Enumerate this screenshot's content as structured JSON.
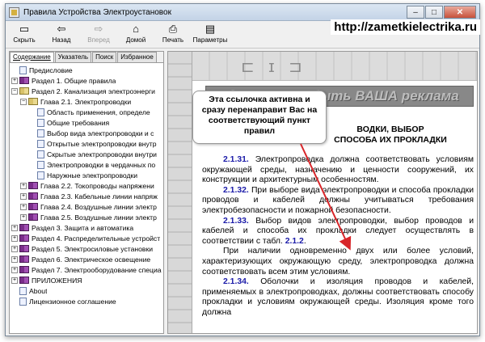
{
  "window": {
    "title": "Правила Устройства Электроустановок",
    "minimize_glyph": "–",
    "maximize_glyph": "□",
    "close_glyph": "✕"
  },
  "watermark": "http://zametkielectrika.ru",
  "toolbar": [
    {
      "name": "hide",
      "label": "Скрыть",
      "icon": "hide-icon",
      "glyph": "▭",
      "enabled": true
    },
    {
      "name": "back",
      "label": "Назад",
      "icon": "back-arrow-icon",
      "glyph": "⇦",
      "enabled": true
    },
    {
      "name": "forward",
      "label": "Вперед",
      "icon": "forward-arrow-icon",
      "glyph": "⇨",
      "enabled": false
    },
    {
      "name": "home",
      "label": "Домой",
      "icon": "home-icon",
      "glyph": "⌂",
      "enabled": true
    },
    {
      "name": "print",
      "label": "Печать",
      "icon": "printer-icon",
      "glyph": "⎙",
      "enabled": true
    },
    {
      "name": "options",
      "label": "Параметры",
      "icon": "options-icon",
      "glyph": "▤",
      "enabled": true
    }
  ],
  "tabs": [
    {
      "label": "Содержание",
      "active": true
    },
    {
      "label": "Указатель",
      "active": false
    },
    {
      "label": "Поиск",
      "active": false
    },
    {
      "label": "Избранное",
      "active": false
    }
  ],
  "tree": [
    {
      "level": 0,
      "type": "page",
      "expander": "",
      "label": "Предисловие"
    },
    {
      "level": 0,
      "type": "book",
      "expander": "+",
      "label": "Раздел 1. Общие правила"
    },
    {
      "level": 0,
      "type": "book-open",
      "expander": "−",
      "label": "Раздел 2. Канализация электроэнерги"
    },
    {
      "level": 1,
      "type": "book-open",
      "expander": "−",
      "label": "Глава 2.1. Электропроводки"
    },
    {
      "level": 2,
      "type": "page",
      "expander": "",
      "label": "Область применения, определе"
    },
    {
      "level": 2,
      "type": "page",
      "expander": "",
      "label": "Общие требования"
    },
    {
      "level": 2,
      "type": "page",
      "expander": "",
      "label": "Выбор вида электропроводки и с"
    },
    {
      "level": 2,
      "type": "page",
      "expander": "",
      "label": "Открытые электропроводки внутр"
    },
    {
      "level": 2,
      "type": "page",
      "expander": "",
      "label": "Скрытые электропроводки внутри"
    },
    {
      "level": 2,
      "type": "page",
      "expander": "",
      "label": "Электропроводки в чердачных по"
    },
    {
      "level": 2,
      "type": "page",
      "expander": "",
      "label": "Наружные электропроводки"
    },
    {
      "level": 1,
      "type": "book",
      "expander": "+",
      "label": "Глава 2.2. Токопроводы напряжени"
    },
    {
      "level": 1,
      "type": "book",
      "expander": "+",
      "label": "Глава 2.3. Кабельные линии напряж"
    },
    {
      "level": 1,
      "type": "book",
      "expander": "+",
      "label": "Глава 2.4. Воздушные линии электр"
    },
    {
      "level": 1,
      "type": "book",
      "expander": "+",
      "label": "Глава 2.5. Воздушные линии электр"
    },
    {
      "level": 0,
      "type": "book",
      "expander": "+",
      "label": "Раздел 3. Защита и автоматика"
    },
    {
      "level": 0,
      "type": "book",
      "expander": "+",
      "label": "Раздел 4. Распределительные устройст"
    },
    {
      "level": 0,
      "type": "book",
      "expander": "+",
      "label": "Раздел 5. Электросиловые установки"
    },
    {
      "level": 0,
      "type": "book",
      "expander": "+",
      "label": "Раздел 6. Электрическое освещение"
    },
    {
      "level": 0,
      "type": "book",
      "expander": "+",
      "label": "Раздел 7. Электрооборудование специа"
    },
    {
      "level": 0,
      "type": "book",
      "expander": "+",
      "label": "ПРИЛОЖЕНИЯ"
    },
    {
      "level": 0,
      "type": "page",
      "expander": "",
      "label": "About"
    },
    {
      "level": 0,
      "type": "page",
      "expander": "",
      "label": "Лицензионное соглашение"
    }
  ],
  "content": {
    "header_glyphs": "⊏ ɪ ⊐",
    "banner": "Здесь могла быть ВАША реклама",
    "heading_line1": "ВОДКИ, ВЫБОР",
    "heading_line2": "СПОСОБА ИХ ПРОКЛАДКИ",
    "paragraphs": [
      {
        "num": "2.1.31.",
        "text": " Электропроводка должна соответствовать условиям окружающей среды, назначению и ценности сооружений, их конструкции и архитектурным особенностям."
      },
      {
        "num": "2.1.32.",
        "text": " При выборе вида электропроводки и способа прокладки проводов и кабелей должны учитываться требования электробезопасности и пожарной безопасности."
      },
      {
        "num": "2.1.33.",
        "text": " Выбор видов электропроводки, выбор проводов и кабелей и способа их прокладки следует осуществлять в соответствии с табл. ",
        "link": "2.1.2",
        "after": "."
      },
      {
        "num": "",
        "text": "При наличии одновременно двух или более условий, характеризующих окружающую среду, электропроводка должна соответствовать всем этим условиям."
      },
      {
        "num": "2.1.34.",
        "text": " Оболочки и изоляция проводов и кабелей, применяемых в электропроводках, должны соответствовать способу прокладки и условиям окружающей среды. Изоляция кроме того должна"
      }
    ]
  },
  "callout": "Эта ссылочка активна и сразу перенаправит Вас на соответствующий пункт правил",
  "colors": {
    "link": "#1a1aa8",
    "arrow": "#d8262a"
  }
}
